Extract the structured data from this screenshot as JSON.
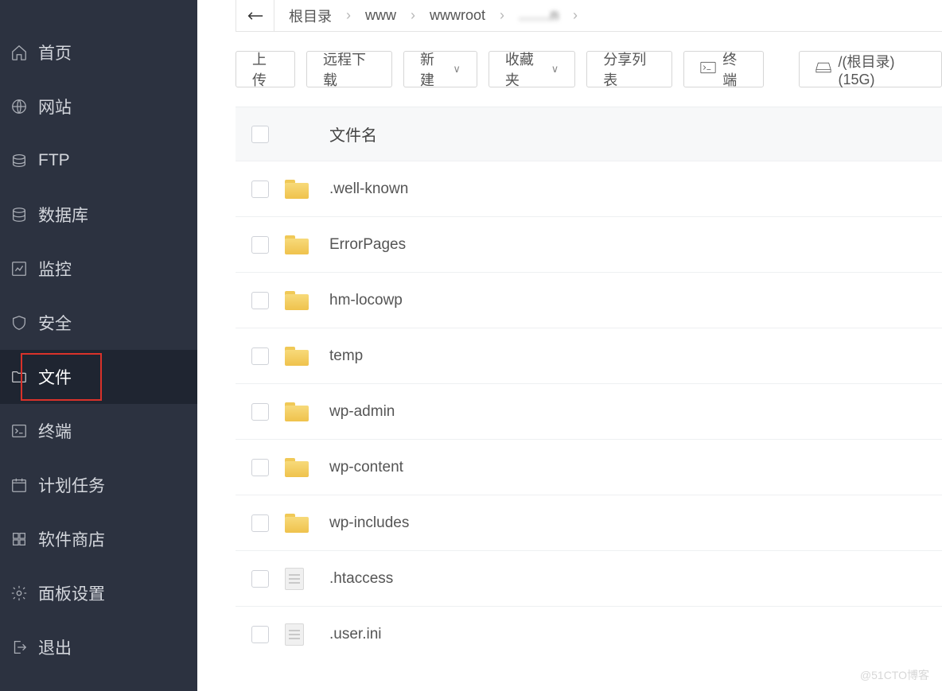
{
  "sidebar": {
    "items": [
      {
        "key": "home",
        "label": "首页"
      },
      {
        "key": "site",
        "label": "网站"
      },
      {
        "key": "ftp",
        "label": "FTP"
      },
      {
        "key": "db",
        "label": "数据库"
      },
      {
        "key": "monitor",
        "label": "监控"
      },
      {
        "key": "security",
        "label": "安全"
      },
      {
        "key": "files",
        "label": "文件",
        "active": true
      },
      {
        "key": "terminal",
        "label": "终端"
      },
      {
        "key": "cron",
        "label": "计划任务"
      },
      {
        "key": "appstore",
        "label": "软件商店"
      },
      {
        "key": "settings",
        "label": "面板设置"
      },
      {
        "key": "logout",
        "label": "退出"
      }
    ]
  },
  "breadcrumb": {
    "items": [
      "根目录",
      "www",
      "wwwroot",
      "........n"
    ]
  },
  "toolbar": {
    "upload": "上传",
    "remote": "远程下载",
    "new": "新建",
    "fav": "收藏夹",
    "share": "分享列表",
    "terminal": "终端",
    "disk": "/(根目录) (15G)"
  },
  "columns": {
    "name": "文件名"
  },
  "files": [
    {
      "type": "folder",
      "name": ".well-known"
    },
    {
      "type": "folder",
      "name": "ErrorPages"
    },
    {
      "type": "folder",
      "name": "hm-locowp"
    },
    {
      "type": "folder",
      "name": "temp"
    },
    {
      "type": "folder",
      "name": "wp-admin"
    },
    {
      "type": "folder",
      "name": "wp-content"
    },
    {
      "type": "folder",
      "name": "wp-includes"
    },
    {
      "type": "file",
      "name": ".htaccess"
    },
    {
      "type": "file",
      "name": ".user.ini"
    }
  ],
  "watermark": "@51CTO博客"
}
